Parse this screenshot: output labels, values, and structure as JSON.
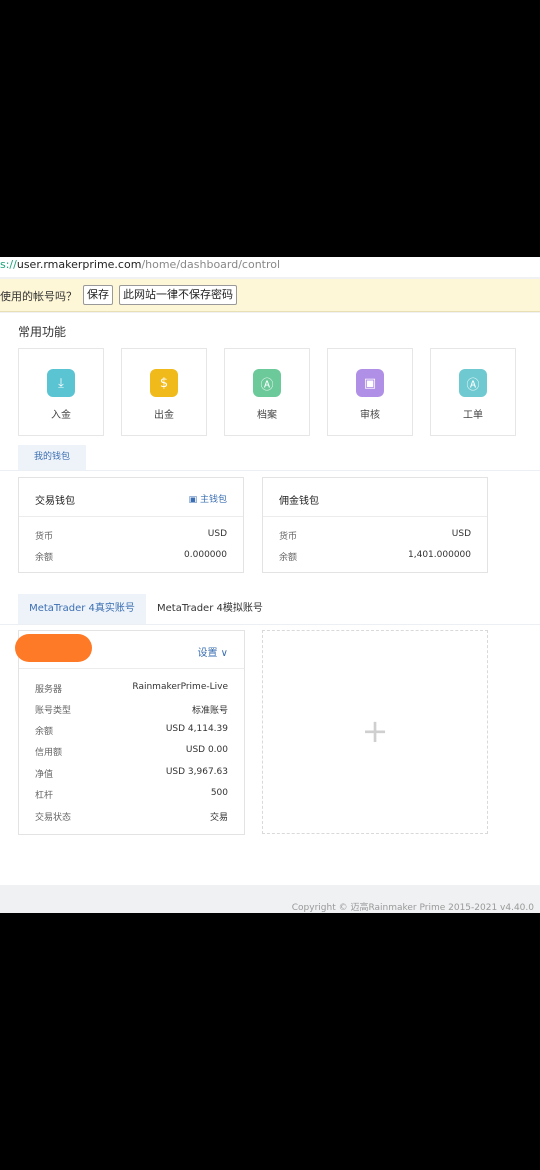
{
  "browser": {
    "url_scheme": "s://",
    "url_host": "user.rmakerprime.com",
    "url_path": "/home/dashboard/control"
  },
  "password_prompt": {
    "question": "使用的帐号吗？",
    "save_label": "保存",
    "never_label": "此网站一律不保存密码"
  },
  "functions": {
    "title": "常用功能",
    "items": [
      {
        "label": "入金",
        "icon": "deposit-icon",
        "color": "#5bc4d3",
        "glyph": "⤓"
      },
      {
        "label": "出金",
        "icon": "withdraw-money-bag-icon",
        "color": "#f0ba1a",
        "glyph": "$"
      },
      {
        "label": "档案",
        "icon": "profile-icon",
        "color": "#6cc99a",
        "glyph": "Ⓐ"
      },
      {
        "label": "审核",
        "icon": "review-icon",
        "color": "#b08fe6",
        "glyph": "▣"
      },
      {
        "label": "工单",
        "icon": "ticket-icon",
        "color": "#6ecad0",
        "glyph": "Ⓐ"
      }
    ]
  },
  "wallet": {
    "tab": "我的钱包",
    "trading": {
      "title": "交易钱包",
      "main_wallet": "主钱包",
      "currency_label": "货币",
      "currency_value": "USD",
      "balance_label": "余额",
      "balance_value": "0.000000"
    },
    "commission": {
      "title": "佣金钱包",
      "currency_label": "货币",
      "currency_value": "USD",
      "balance_label": "余额",
      "balance_value": "1,401.000000"
    }
  },
  "mt_tabs": {
    "real": "MetaTrader 4真实账号",
    "demo": "MetaTrader 4模拟账号"
  },
  "account": {
    "settings_label": "设置",
    "rows": [
      {
        "label": "服务器",
        "value": "RainmakerPrime-Live"
      },
      {
        "label": "账号类型",
        "value": "标准账号"
      },
      {
        "label": "余额",
        "value": "USD 4,114.39"
      },
      {
        "label": "信用额",
        "value": "USD 0.00"
      },
      {
        "label": "净值",
        "value": "USD 3,967.63"
      },
      {
        "label": "杠杆",
        "value": "500"
      },
      {
        "label": "交易状态",
        "value": "交易"
      }
    ]
  },
  "add_account_symbol": "+",
  "footer": "Copyright © 迈高Rainmaker Prime 2015-2021 v4.40.0"
}
